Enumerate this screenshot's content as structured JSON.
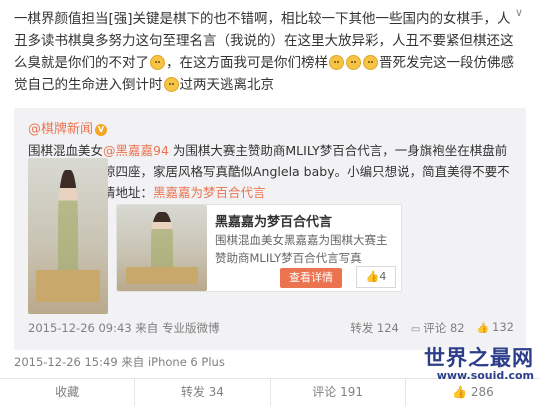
{
  "post": {
    "seg1": "一棋界颜值担当[强]关键是棋下的也不错啊，相比较一下其他一些国内的女棋手，人丑多读书棋臭多努力这句至理名言（我说的）在这里大放异彩，人丑不要紧但棋还这么臭就是你们的不对了",
    "seg2": "，在这方面我可是你们榜样",
    "seg3": "晋死发完这一段仿佛感觉自己的生命进入倒计时",
    "seg4": "过两天逃离北京",
    "time": "2015-12-26 15:49",
    "source": "来自 iPhone 6 Plus"
  },
  "repost": {
    "author": "@棋牌新闻",
    "text1": "围棋混血美女",
    "mention": "@黑嘉嘉94",
    "text2": " 为围棋大赛主赞助商MLILY梦百合代言，一身旗袍坐在棋盘前超凡脱俗，艳惊四座，家居风格写真酷似Anglela baby。小编只想说，简直美得不要不要的！更多高清地址：",
    "link": "黑嘉嘉为梦百合代言",
    "card": {
      "title": "黑嘉嘉为梦百合代言",
      "desc": "围棋混血美女黑嘉嘉为围棋大赛主赞助商MLILY梦百合代言写真",
      "button": "查看详情",
      "likes": "4"
    },
    "time": "2015-12-26 09:43",
    "source": "来自 专业版微博",
    "reposts": "转发 124",
    "comments": "评论 82",
    "likes": "132"
  },
  "footer": {
    "collect": "收藏",
    "repost": "转发 34",
    "comment": "评论 191",
    "like": "286"
  },
  "watermark": {
    "cn": "世界之最网",
    "url": "www.souid.com"
  },
  "colors": {
    "accent": "#eb7350",
    "repost_bg": "#f2f2f5"
  }
}
